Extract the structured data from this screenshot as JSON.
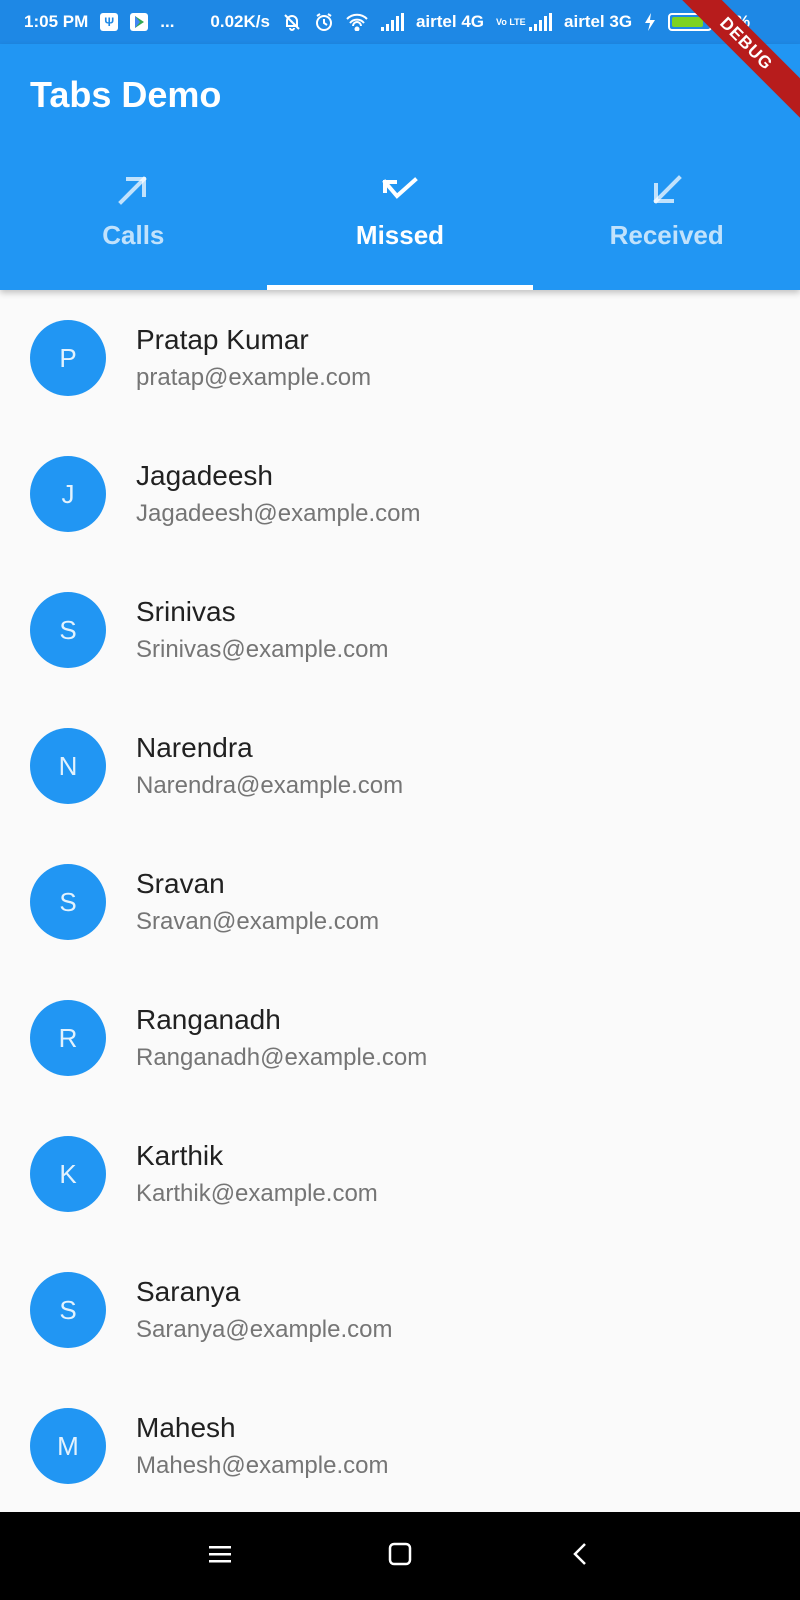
{
  "status_bar": {
    "time": "1:05 PM",
    "more": "...",
    "speed": "0.02K/s",
    "carrier1": "airtel 4G",
    "volte": "Vo LTE",
    "carrier2": "airtel 3G",
    "battery": "86%",
    "battery_level": 0.86
  },
  "app_bar": {
    "title": "Tabs Demo",
    "tabs": [
      {
        "label": "Calls",
        "icon": "arrow-up-right-icon",
        "active": false
      },
      {
        "label": "Missed",
        "icon": "call-missed-icon",
        "active": true
      },
      {
        "label": "Received",
        "icon": "arrow-down-left-icon",
        "active": false
      }
    ]
  },
  "debug_banner": "DEBUG",
  "contacts": [
    {
      "initial": "P",
      "name": "Pratap Kumar",
      "email": "pratap@example.com"
    },
    {
      "initial": "J",
      "name": "Jagadeesh",
      "email": "Jagadeesh@example.com"
    },
    {
      "initial": "S",
      "name": "Srinivas",
      "email": "Srinivas@example.com"
    },
    {
      "initial": "N",
      "name": "Narendra",
      "email": "Narendra@example.com"
    },
    {
      "initial": "S",
      "name": "Sravan",
      "email": "Sravan@example.com"
    },
    {
      "initial": "R",
      "name": "Ranganadh",
      "email": "Ranganadh@example.com"
    },
    {
      "initial": "K",
      "name": "Karthik",
      "email": "Karthik@example.com"
    },
    {
      "initial": "S",
      "name": "Saranya",
      "email": "Saranya@example.com"
    },
    {
      "initial": "M",
      "name": "Mahesh",
      "email": "Mahesh@example.com"
    }
  ],
  "colors": {
    "primary": "#2196f3",
    "status_bar": "#1e88e5",
    "avatar": "#2196f3",
    "nav_bar": "#000000"
  },
  "nav_bar": {
    "icons": [
      "menu-icon",
      "home-icon",
      "back-icon"
    ]
  }
}
